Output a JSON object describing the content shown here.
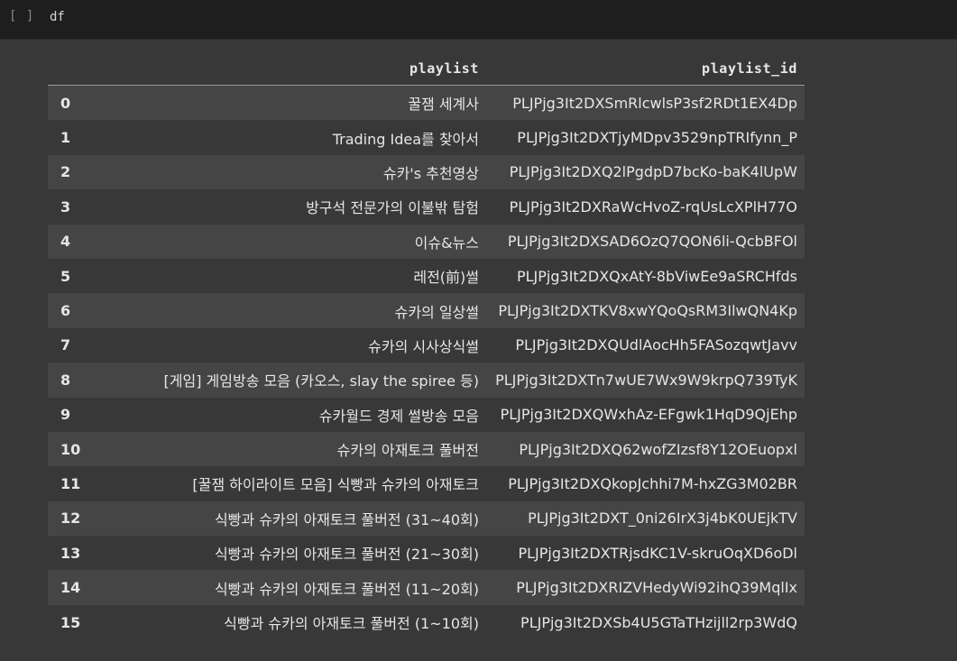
{
  "cell": {
    "run_indicator": "[ ]",
    "code": "df"
  },
  "table": {
    "columns": [
      "",
      "playlist",
      "playlist_id"
    ],
    "rows": [
      {
        "index": "0",
        "playlist": "꿀잼 세계사",
        "playlist_id": "PLJPjg3It2DXSmRlcwlsP3sf2RDt1EX4Dp"
      },
      {
        "index": "1",
        "playlist": "Trading Idea를 찾아서",
        "playlist_id": "PLJPjg3It2DXTjyMDpv3529npTRIfynn_P"
      },
      {
        "index": "2",
        "playlist": "슈카's 추천영상",
        "playlist_id": "PLJPjg3It2DXQ2lPgdpD7bcKo-baK4lUpW"
      },
      {
        "index": "3",
        "playlist": "방구석 전문가의 이불밖 탐험",
        "playlist_id": "PLJPjg3It2DXRaWcHvoZ-rqUsLcXPlH77O"
      },
      {
        "index": "4",
        "playlist": "이슈&뉴스",
        "playlist_id": "PLJPjg3It2DXSAD6OzQ7QON6li-QcbBFOl"
      },
      {
        "index": "5",
        "playlist": "레전(前)썰",
        "playlist_id": "PLJPjg3It2DXQxAtY-8bViwEe9aSRCHfds"
      },
      {
        "index": "6",
        "playlist": "슈카의 일상썰",
        "playlist_id": "PLJPjg3It2DXTKV8xwYQoQsRM3IlwQN4Kp"
      },
      {
        "index": "7",
        "playlist": "슈카의 시사상식썰",
        "playlist_id": "PLJPjg3It2DXQUdlAocHh5FASozqwtJavv"
      },
      {
        "index": "8",
        "playlist": "[게임] 게임방송 모음 (카오스, slay the spiree 등)",
        "playlist_id": "PLJPjg3It2DXTn7wUE7Wx9W9krpQ739TyK"
      },
      {
        "index": "9",
        "playlist": "슈카월드 경제 썰방송 모음",
        "playlist_id": "PLJPjg3It2DXQWxhAz-EFgwk1HqD9QjEhp"
      },
      {
        "index": "10",
        "playlist": "슈카의 아재토크 풀버전",
        "playlist_id": "PLJPjg3It2DXQ62wofZIzsf8Y12OEuopxl"
      },
      {
        "index": "11",
        "playlist": "[꿀잼 하이라이트 모음] 식빵과 슈카의 아재토크",
        "playlist_id": "PLJPjg3It2DXQkopJchhi7M-hxZG3M02BR"
      },
      {
        "index": "12",
        "playlist": "식빵과 슈카의 아재토크 풀버전 (31~40회)",
        "playlist_id": "PLJPjg3It2DXT_0ni26IrX3j4bK0UEjkTV"
      },
      {
        "index": "13",
        "playlist": "식빵과 슈카의 아재토크 풀버전 (21~30회)",
        "playlist_id": "PLJPjg3It2DXTRjsdKC1V-skruOqXD6oDl"
      },
      {
        "index": "14",
        "playlist": "식빵과 슈카의 아재토크 풀버전 (11~20회)",
        "playlist_id": "PLJPjg3It2DXRIZVHedyWi92ihQ39MqlIx"
      },
      {
        "index": "15",
        "playlist": "식빵과 슈카의 아재토크 풀버전 (1~10회)",
        "playlist_id": "PLJPjg3It2DXSb4U5GTaTHzijll2rp3WdQ"
      }
    ]
  }
}
